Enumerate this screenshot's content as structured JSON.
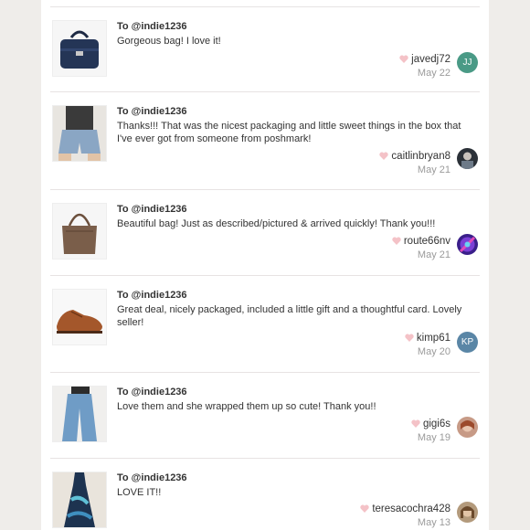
{
  "reviews": [
    {
      "to": "To @indie1236",
      "message": "Gorgeous bag! I love it!",
      "username": "javedj72",
      "date": "May 22",
      "avatar_initials": "JJ",
      "avatar_color": "#4a9a86",
      "item": "navy handbag"
    },
    {
      "to": "To @indie1236",
      "message": "Thanks!!! That was the nicest packaging and little sweet things in the box that I've ever got from someone from poshmark!",
      "username": "caitlinbryan8",
      "date": "May 21",
      "avatar_initials": "",
      "item": "denim shorts"
    },
    {
      "to": "To @indie1236",
      "message": "Beautiful bag! Just as described/pictured & arrived quickly! Thank you!!!",
      "username": "route66nv",
      "date": "May 21",
      "avatar_initials": "",
      "item": "brown leather bag"
    },
    {
      "to": "To @indie1236",
      "message": "Great deal, nicely packaged, included a little gift and a thoughtful card. Lovely seller!",
      "username": "kimp61",
      "date": "May 20",
      "avatar_initials": "KP",
      "avatar_color": "#5a86a6",
      "item": "brown oxford shoes"
    },
    {
      "to": "To @indie1236",
      "message": "Love them and she wrapped them up so cute! Thank you!!",
      "username": "gigi6s",
      "date": "May 19",
      "avatar_initials": "",
      "item": "wide leg jeans"
    },
    {
      "to": "To @indie1236",
      "message": "LOVE IT!!",
      "username": "teresacochra428",
      "date": "May 13",
      "avatar_initials": "",
      "item": "tie-dye dress"
    }
  ],
  "colors": {
    "heart": "#f4c2c7",
    "divider": "#e7e3e3",
    "date": "#9a9a9a",
    "background": "#efedea"
  }
}
